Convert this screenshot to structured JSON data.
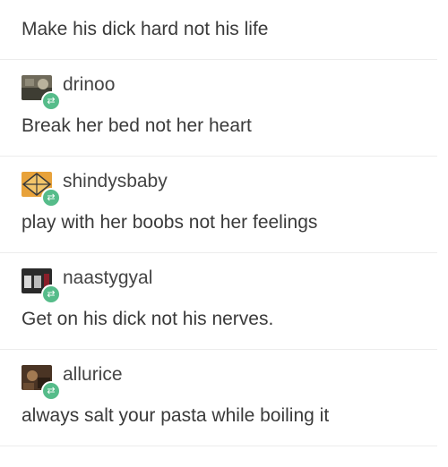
{
  "thread": {
    "top_text": "Make his dick hard not his life",
    "replies": [
      {
        "username": "drinoo",
        "text": "Break her bed not her heart",
        "avatar_icon": "blog-avatar-icon"
      },
      {
        "username": "shindysbaby",
        "text": "play with her boobs not her feelings",
        "avatar_icon": "blog-avatar-icon"
      },
      {
        "username": "naastygyal",
        "text": "Get on his dick not his nerves.",
        "avatar_icon": "blog-avatar-icon"
      },
      {
        "username": "allurice",
        "text": "always salt your pasta while boiling it",
        "avatar_icon": "blog-avatar-icon"
      }
    ],
    "reblog_icon": "reblog-icon",
    "reblog_glyph": "⇄",
    "reblog_color": "#56bc8a",
    "divider_color": "#ececec"
  }
}
